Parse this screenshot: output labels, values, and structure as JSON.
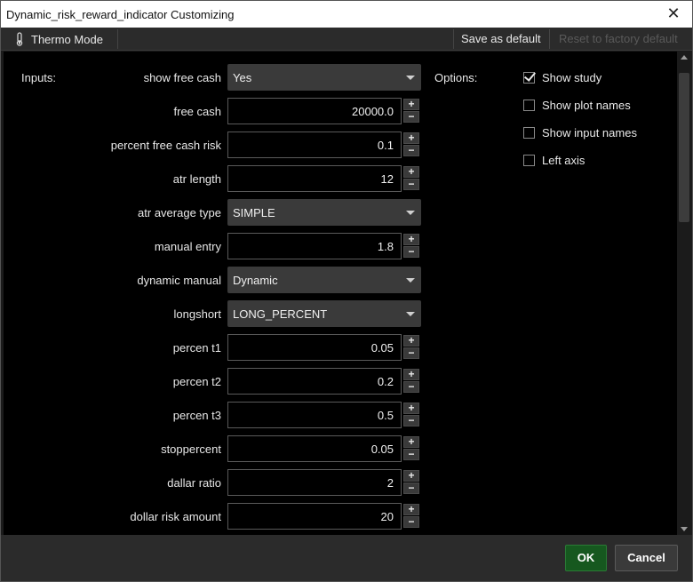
{
  "window": {
    "title": "Dynamic_risk_reward_indicator Customizing",
    "close_symbol": "✕"
  },
  "toolbar": {
    "thermo_icon": "thermometer-icon",
    "thermo_label": "Thermo Mode",
    "save_default_label": "Save as default",
    "reset_default_label": "Reset to factory default"
  },
  "inputs": {
    "section_label": "Inputs:",
    "rows": [
      {
        "label": "show free cash",
        "type": "select",
        "value": "Yes"
      },
      {
        "label": "free cash",
        "type": "number",
        "value": "20000.0"
      },
      {
        "label": "percent free cash risk",
        "type": "number",
        "value": "0.1"
      },
      {
        "label": "atr length",
        "type": "number",
        "value": "12"
      },
      {
        "label": "atr average type",
        "type": "select",
        "value": "SIMPLE"
      },
      {
        "label": "manual entry",
        "type": "number",
        "value": "1.8"
      },
      {
        "label": "dynamic manual",
        "type": "select",
        "value": "Dynamic"
      },
      {
        "label": "longshort",
        "type": "select",
        "value": "LONG_PERCENT"
      },
      {
        "label": "percen t1",
        "type": "number",
        "value": "0.05"
      },
      {
        "label": "percen t2",
        "type": "number",
        "value": "0.2"
      },
      {
        "label": "percen t3",
        "type": "number",
        "value": "0.5"
      },
      {
        "label": "stoppercent",
        "type": "number",
        "value": "0.05"
      },
      {
        "label": "dallar ratio",
        "type": "number",
        "value": "2"
      },
      {
        "label": "dollar risk amount",
        "type": "number",
        "value": "20"
      }
    ],
    "spin_up": "+",
    "spin_down": "−"
  },
  "options": {
    "section_label": "Options:",
    "items": [
      {
        "label": "Show study",
        "checked": true
      },
      {
        "label": "Show plot names",
        "checked": false
      },
      {
        "label": "Show input names",
        "checked": false
      },
      {
        "label": "Left axis",
        "checked": false
      }
    ]
  },
  "footer": {
    "ok_label": "OK",
    "cancel_label": "Cancel"
  },
  "colors": {
    "ok_button": "#16581f",
    "background": "#000000",
    "panel": "#2b2b2b"
  }
}
